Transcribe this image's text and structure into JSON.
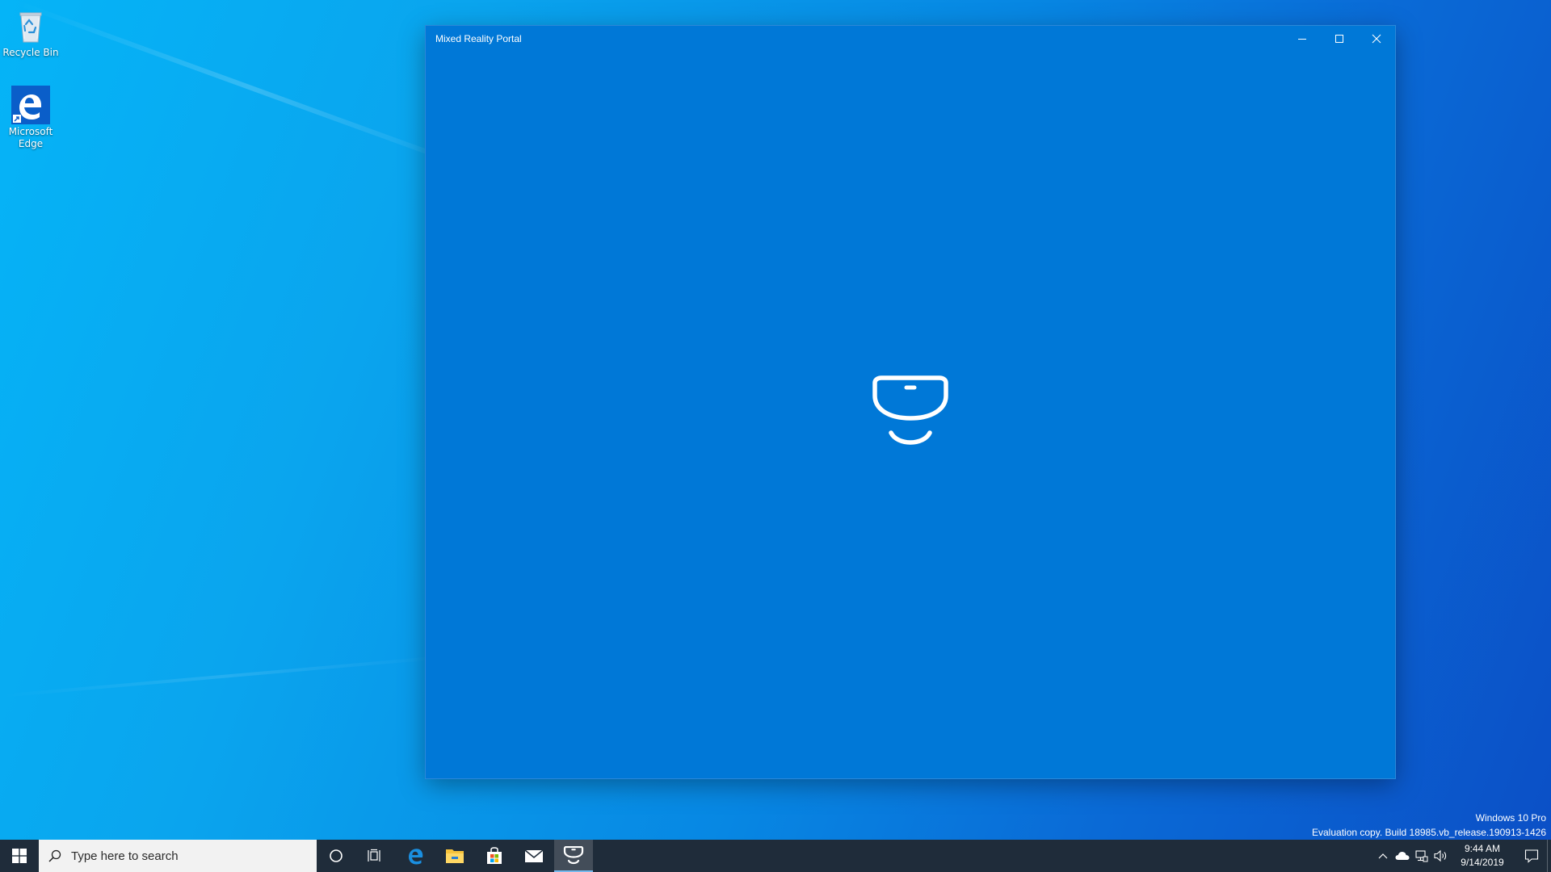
{
  "desktop": {
    "icons": [
      {
        "label": "Recycle Bin",
        "icon": "recycle-bin-icon"
      },
      {
        "label": "Microsoft\nEdge",
        "icon": "edge-icon"
      }
    ]
  },
  "window": {
    "title": "Mixed Reality Portal",
    "background": "#0078d7",
    "controls": {
      "minimize": "minimize-icon",
      "maximize": "maximize-icon",
      "close": "close-icon"
    },
    "splash_icon": "mixed-reality-headset-icon"
  },
  "watermark": {
    "edition": "Windows 10 Pro",
    "build": "Evaluation copy. Build 18985.vb_release.190913-1426"
  },
  "taskbar": {
    "background": "#1f2c3a",
    "search_placeholder": "Type here to search",
    "pinned": [
      "cortana-icon",
      "task-view-icon",
      "edge-icon",
      "file-explorer-icon",
      "store-icon",
      "mail-icon",
      "mixed-reality-portal-icon"
    ],
    "active_app": "Mixed Reality Portal",
    "clock": {
      "time": "9:44 AM",
      "date": "9/14/2019"
    }
  }
}
